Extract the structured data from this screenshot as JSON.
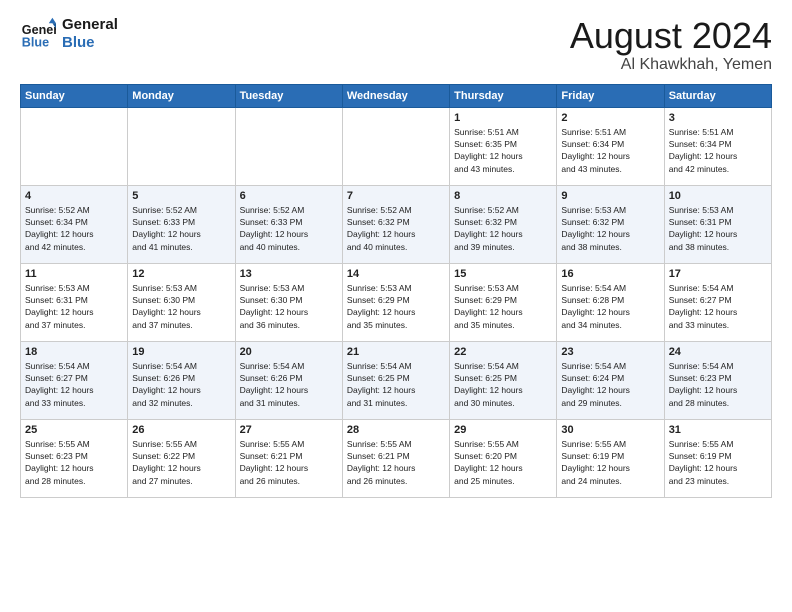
{
  "header": {
    "logo_line1": "General",
    "logo_line2": "Blue",
    "month_year": "August 2024",
    "location": "Al Khawkhah, Yemen"
  },
  "days_of_week": [
    "Sunday",
    "Monday",
    "Tuesday",
    "Wednesday",
    "Thursday",
    "Friday",
    "Saturday"
  ],
  "weeks": [
    [
      {
        "num": "",
        "info": ""
      },
      {
        "num": "",
        "info": ""
      },
      {
        "num": "",
        "info": ""
      },
      {
        "num": "",
        "info": ""
      },
      {
        "num": "1",
        "info": "Sunrise: 5:51 AM\nSunset: 6:35 PM\nDaylight: 12 hours\nand 43 minutes."
      },
      {
        "num": "2",
        "info": "Sunrise: 5:51 AM\nSunset: 6:34 PM\nDaylight: 12 hours\nand 43 minutes."
      },
      {
        "num": "3",
        "info": "Sunrise: 5:51 AM\nSunset: 6:34 PM\nDaylight: 12 hours\nand 42 minutes."
      }
    ],
    [
      {
        "num": "4",
        "info": "Sunrise: 5:52 AM\nSunset: 6:34 PM\nDaylight: 12 hours\nand 42 minutes."
      },
      {
        "num": "5",
        "info": "Sunrise: 5:52 AM\nSunset: 6:33 PM\nDaylight: 12 hours\nand 41 minutes."
      },
      {
        "num": "6",
        "info": "Sunrise: 5:52 AM\nSunset: 6:33 PM\nDaylight: 12 hours\nand 40 minutes."
      },
      {
        "num": "7",
        "info": "Sunrise: 5:52 AM\nSunset: 6:32 PM\nDaylight: 12 hours\nand 40 minutes."
      },
      {
        "num": "8",
        "info": "Sunrise: 5:52 AM\nSunset: 6:32 PM\nDaylight: 12 hours\nand 39 minutes."
      },
      {
        "num": "9",
        "info": "Sunrise: 5:53 AM\nSunset: 6:32 PM\nDaylight: 12 hours\nand 38 minutes."
      },
      {
        "num": "10",
        "info": "Sunrise: 5:53 AM\nSunset: 6:31 PM\nDaylight: 12 hours\nand 38 minutes."
      }
    ],
    [
      {
        "num": "11",
        "info": "Sunrise: 5:53 AM\nSunset: 6:31 PM\nDaylight: 12 hours\nand 37 minutes."
      },
      {
        "num": "12",
        "info": "Sunrise: 5:53 AM\nSunset: 6:30 PM\nDaylight: 12 hours\nand 37 minutes."
      },
      {
        "num": "13",
        "info": "Sunrise: 5:53 AM\nSunset: 6:30 PM\nDaylight: 12 hours\nand 36 minutes."
      },
      {
        "num": "14",
        "info": "Sunrise: 5:53 AM\nSunset: 6:29 PM\nDaylight: 12 hours\nand 35 minutes."
      },
      {
        "num": "15",
        "info": "Sunrise: 5:53 AM\nSunset: 6:29 PM\nDaylight: 12 hours\nand 35 minutes."
      },
      {
        "num": "16",
        "info": "Sunrise: 5:54 AM\nSunset: 6:28 PM\nDaylight: 12 hours\nand 34 minutes."
      },
      {
        "num": "17",
        "info": "Sunrise: 5:54 AM\nSunset: 6:27 PM\nDaylight: 12 hours\nand 33 minutes."
      }
    ],
    [
      {
        "num": "18",
        "info": "Sunrise: 5:54 AM\nSunset: 6:27 PM\nDaylight: 12 hours\nand 33 minutes."
      },
      {
        "num": "19",
        "info": "Sunrise: 5:54 AM\nSunset: 6:26 PM\nDaylight: 12 hours\nand 32 minutes."
      },
      {
        "num": "20",
        "info": "Sunrise: 5:54 AM\nSunset: 6:26 PM\nDaylight: 12 hours\nand 31 minutes."
      },
      {
        "num": "21",
        "info": "Sunrise: 5:54 AM\nSunset: 6:25 PM\nDaylight: 12 hours\nand 31 minutes."
      },
      {
        "num": "22",
        "info": "Sunrise: 5:54 AM\nSunset: 6:25 PM\nDaylight: 12 hours\nand 30 minutes."
      },
      {
        "num": "23",
        "info": "Sunrise: 5:54 AM\nSunset: 6:24 PM\nDaylight: 12 hours\nand 29 minutes."
      },
      {
        "num": "24",
        "info": "Sunrise: 5:54 AM\nSunset: 6:23 PM\nDaylight: 12 hours\nand 28 minutes."
      }
    ],
    [
      {
        "num": "25",
        "info": "Sunrise: 5:55 AM\nSunset: 6:23 PM\nDaylight: 12 hours\nand 28 minutes."
      },
      {
        "num": "26",
        "info": "Sunrise: 5:55 AM\nSunset: 6:22 PM\nDaylight: 12 hours\nand 27 minutes."
      },
      {
        "num": "27",
        "info": "Sunrise: 5:55 AM\nSunset: 6:21 PM\nDaylight: 12 hours\nand 26 minutes."
      },
      {
        "num": "28",
        "info": "Sunrise: 5:55 AM\nSunset: 6:21 PM\nDaylight: 12 hours\nand 26 minutes."
      },
      {
        "num": "29",
        "info": "Sunrise: 5:55 AM\nSunset: 6:20 PM\nDaylight: 12 hours\nand 25 minutes."
      },
      {
        "num": "30",
        "info": "Sunrise: 5:55 AM\nSunset: 6:19 PM\nDaylight: 12 hours\nand 24 minutes."
      },
      {
        "num": "31",
        "info": "Sunrise: 5:55 AM\nSunset: 6:19 PM\nDaylight: 12 hours\nand 23 minutes."
      }
    ]
  ]
}
